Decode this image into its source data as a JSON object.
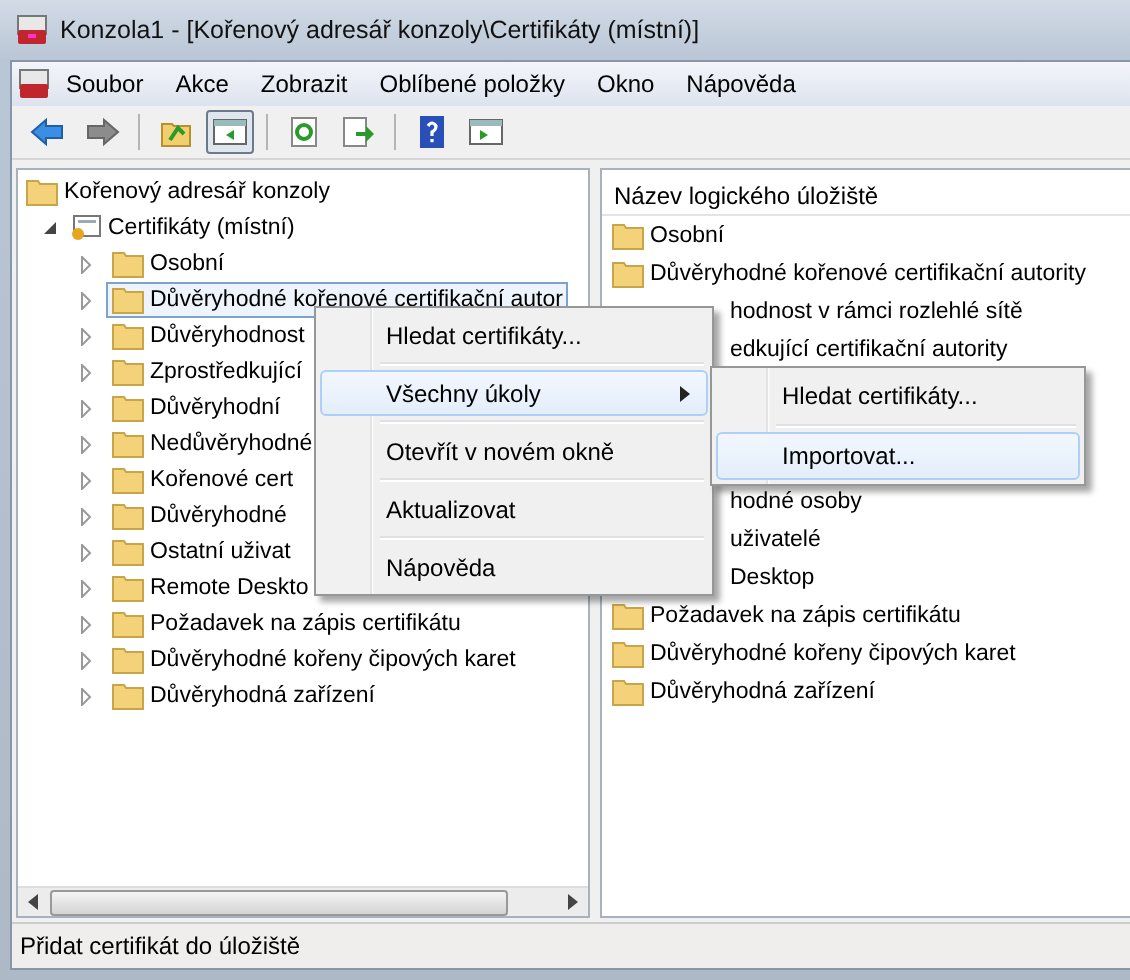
{
  "window": {
    "title": "Konzola1 - [Kořenový adresář konzoly\\Certifikáty (místní)]"
  },
  "menu_bar": [
    "Soubor",
    "Akce",
    "Zobrazit",
    "Oblíbené položky",
    "Okno",
    "Nápověda"
  ],
  "toolbar": [
    {
      "kind": "back",
      "selected": false
    },
    {
      "kind": "forward",
      "selected": false
    },
    {
      "kind": "sep"
    },
    {
      "kind": "up",
      "selected": false
    },
    {
      "kind": "tree",
      "selected": true
    },
    {
      "kind": "sep"
    },
    {
      "kind": "refresh",
      "selected": false
    },
    {
      "kind": "export",
      "selected": false
    },
    {
      "kind": "sep"
    },
    {
      "kind": "help",
      "selected": false
    },
    {
      "kind": "pane",
      "selected": false
    }
  ],
  "tree": [
    {
      "label": "Kořenový adresář konzoly",
      "kind": "folder",
      "children": [
        {
          "label": "Certifikáty (místní)",
          "kind": "cert",
          "expanded": true,
          "children": [
            {
              "label": "Osobní",
              "kind": "folder",
              "expanded": false,
              "selected": false
            },
            {
              "label": "Důvěryhodné kořenové certifikační autor",
              "kind": "folder",
              "expanded": false,
              "selected": true
            },
            {
              "label": "Důvěryhodnost",
              "kind": "folder",
              "expanded": false,
              "selected": false
            },
            {
              "label": "Zprostředkující",
              "kind": "folder",
              "expanded": false,
              "selected": false
            },
            {
              "label": "Důvěryhodní",
              "kind": "folder",
              "expanded": false,
              "selected": false
            },
            {
              "label": "Nedůvěryhodné",
              "kind": "folder",
              "expanded": false,
              "selected": false
            },
            {
              "label": "Kořenové cert",
              "kind": "folder",
              "expanded": false,
              "selected": false
            },
            {
              "label": "Důvěryhodné",
              "kind": "folder",
              "expanded": false,
              "selected": false
            },
            {
              "label": "Ostatní uživat",
              "kind": "folder",
              "expanded": false,
              "selected": false
            },
            {
              "label": "Remote Deskto",
              "kind": "folder",
              "expanded": false,
              "selected": false
            },
            {
              "label": "Požadavek na zápis certifikátu",
              "kind": "folder",
              "expanded": false,
              "selected": false
            },
            {
              "label": "Důvěryhodné kořeny čipových karet",
              "kind": "folder",
              "expanded": false,
              "selected": false
            },
            {
              "label": "Důvěryhodná zařízení",
              "kind": "folder",
              "expanded": false,
              "selected": false
            }
          ]
        }
      ]
    }
  ],
  "list": {
    "column_header": "Název logického úložiště",
    "rows": [
      {
        "text": "Osobní",
        "covered": false
      },
      {
        "text": "Důvěryhodné kořenové certifikační autority",
        "covered": false
      },
      {
        "text": "hodnost v rámci rozlehlé sítě",
        "covered": true
      },
      {
        "text": "edkující certifikační autority",
        "covered": true
      },
      {
        "covered": true
      },
      {
        "covered": true
      },
      {
        "covered": true
      },
      {
        "text": "hodné osoby",
        "covered": true
      },
      {
        "text": "uživatelé",
        "covered": true
      },
      {
        "text": "Desktop",
        "covered": true
      },
      {
        "text": "Požadavek na zápis certifikátu",
        "covered": false
      },
      {
        "text": "Důvěryhodné kořeny čipových karet",
        "covered": false
      },
      {
        "text": "Důvěryhodná zařízení",
        "covered": false
      }
    ]
  },
  "context_menu": [
    {
      "label": "Hledat certifikáty...",
      "selected": false,
      "submenu": false
    },
    {
      "label": "Všechny úkoly",
      "selected": true,
      "submenu": true
    },
    {
      "label": "Otevřít v novém okně",
      "selected": false,
      "submenu": false
    },
    {
      "label": "Aktualizovat",
      "selected": false,
      "submenu": false
    },
    {
      "label": "Nápověda",
      "selected": false,
      "submenu": false
    }
  ],
  "submenu": [
    {
      "label": "Hledat certifikáty...",
      "selected": false
    },
    {
      "label": "Importovat...",
      "selected": true
    }
  ],
  "status_bar": "Přidat certifikát do úložiště"
}
